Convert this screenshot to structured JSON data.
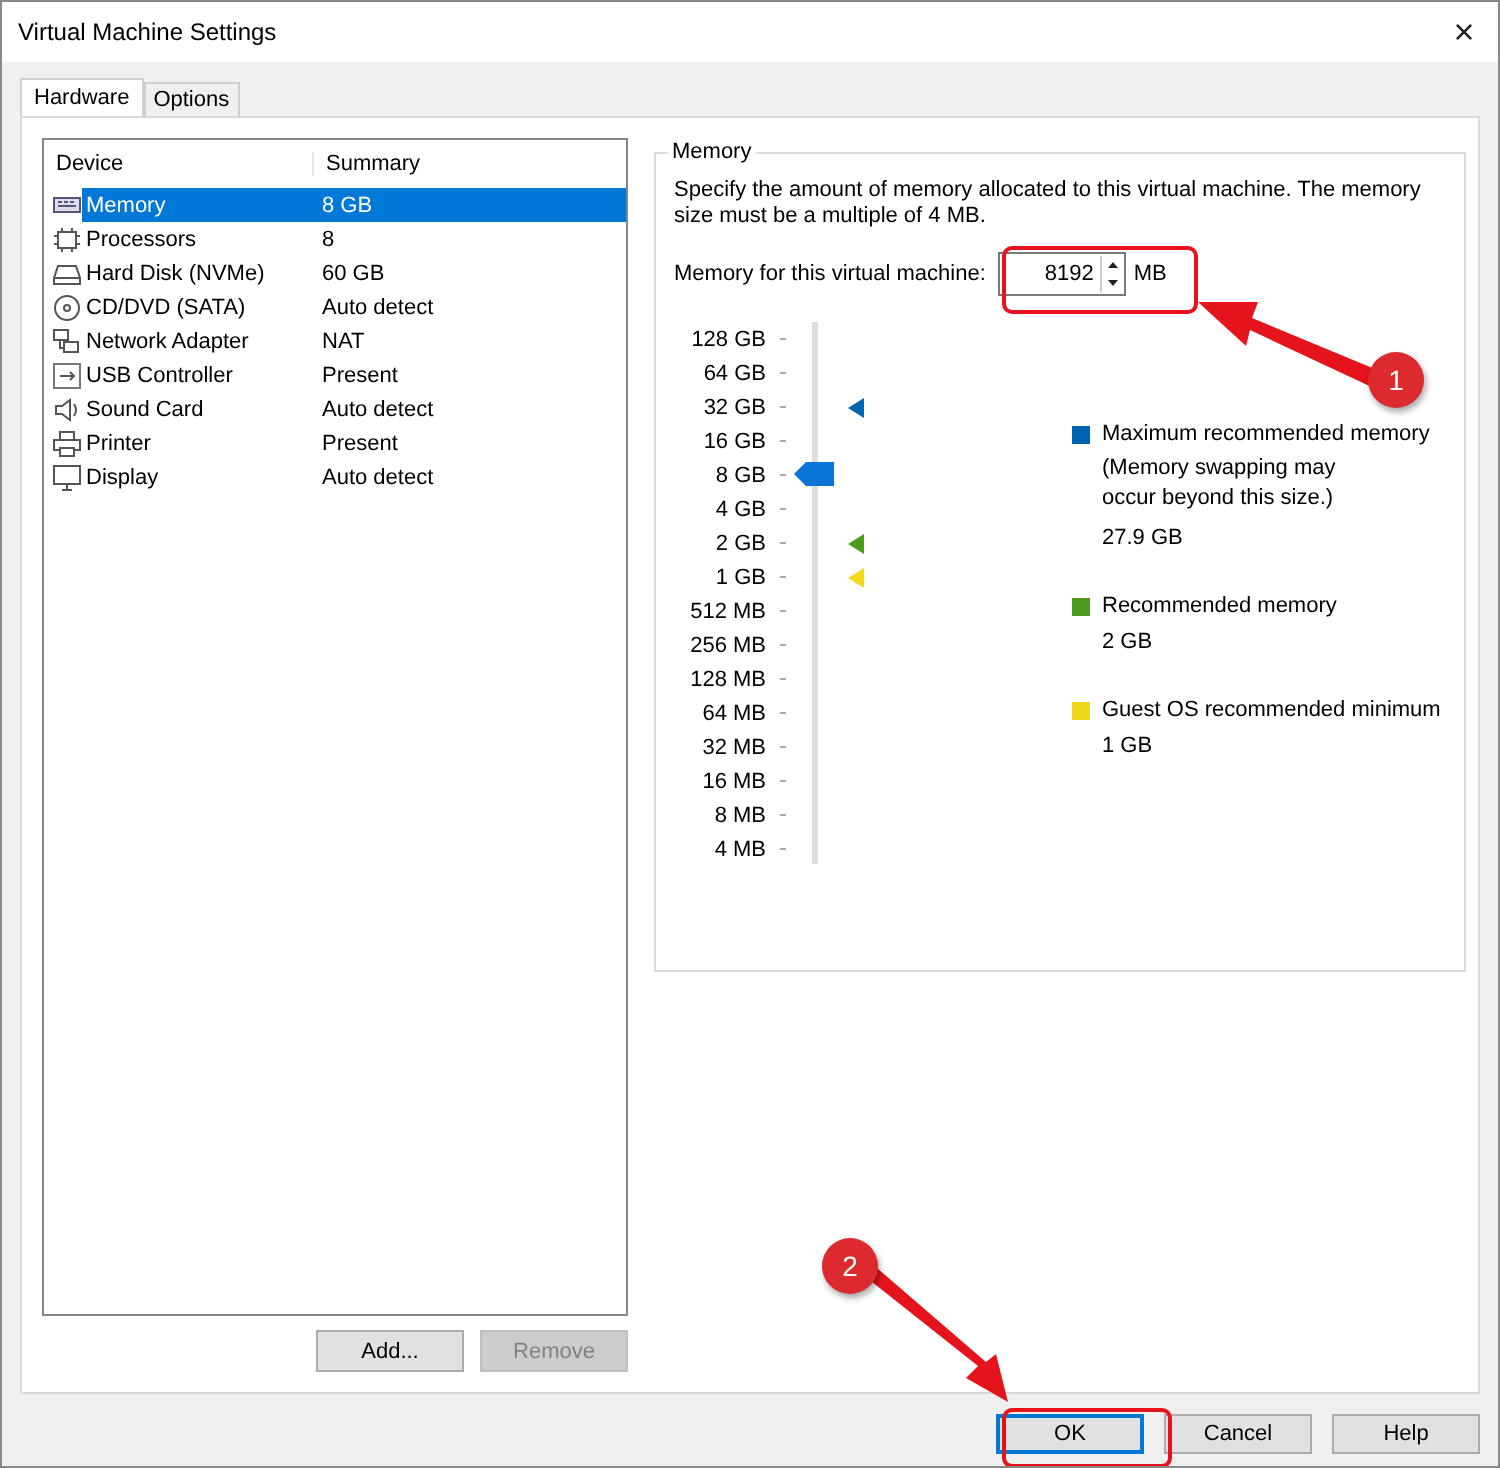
{
  "window": {
    "title": "Virtual Machine Settings",
    "close": "×"
  },
  "tabs": [
    {
      "label": "Hardware",
      "selected": true
    },
    {
      "label": "Options",
      "selected": false
    }
  ],
  "device_table": {
    "columns": [
      "Device",
      "Summary"
    ],
    "rows": [
      {
        "device": "Memory",
        "summary": "8 GB",
        "selected": true
      },
      {
        "device": "Processors",
        "summary": "8",
        "selected": false
      },
      {
        "device": "Hard Disk (NVMe)",
        "summary": "60 GB",
        "selected": false
      },
      {
        "device": "CD/DVD (SATA)",
        "summary": "Auto detect",
        "selected": false
      },
      {
        "device": "Network Adapter",
        "summary": "NAT",
        "selected": false
      },
      {
        "device": "USB Controller",
        "summary": "Present",
        "selected": false
      },
      {
        "device": "Sound Card",
        "summary": "Auto detect",
        "selected": false
      },
      {
        "device": "Printer",
        "summary": "Present",
        "selected": false
      },
      {
        "device": "Display",
        "summary": "Auto detect",
        "selected": false
      }
    ]
  },
  "list_buttons": [
    {
      "label": "Add...",
      "disabled": false
    },
    {
      "label": "Remove",
      "disabled": true
    }
  ],
  "memory": {
    "title": "Memory",
    "description": "Specify the amount of memory allocated to this virtual machine. The memory size must be a multiple of 4 MB.",
    "field_label": "Memory for this virtual machine:",
    "value": "8192",
    "unit": "MB",
    "slider": {
      "ticks": [
        "128 GB",
        "64 GB",
        "32 GB",
        "16 GB",
        "8 GB",
        "4 GB",
        "2 GB",
        "1 GB",
        "512 MB",
        "256 MB",
        "128 MB",
        "64 MB",
        "32 MB",
        "16 MB",
        "8 MB",
        "4 MB"
      ],
      "level": 0.7333
    },
    "legend": [
      {
        "label": "Maximum recommended memory",
        "note": "(Memory swapping may occur beyond this size.)",
        "value": "27.9 GB",
        "color": "#0063b1"
      },
      {
        "label": "Recommended memory",
        "value": "2 GB",
        "color": "#4c9a1e"
      },
      {
        "label": "Guest OS recommended minimum",
        "value": "1 GB",
        "color": "#f2d81c"
      }
    ]
  },
  "buttons": [
    {
      "label": "OK",
      "default": true
    },
    {
      "label": "Cancel",
      "default": false
    },
    {
      "label": "Help",
      "default": false
    }
  ],
  "annotations": [
    {
      "label": "1"
    },
    {
      "label": "2"
    }
  ]
}
